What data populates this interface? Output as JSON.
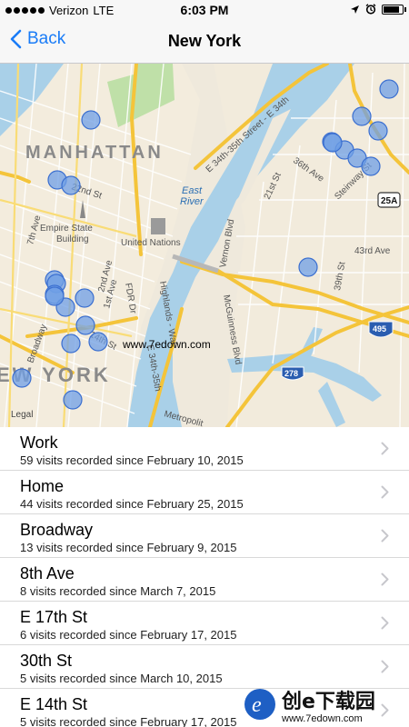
{
  "status_bar": {
    "carrier": "Verizon",
    "network": "LTE",
    "time": "6:03 PM",
    "battery_level": 0.92
  },
  "nav": {
    "back_label": "Back",
    "title": "New York"
  },
  "map": {
    "labels": {
      "manhattan": "MANHATTAN",
      "new_york": "EW YORK",
      "east_34th": "E 34th-35th Street - E 34th",
      "st_36": "36th Ave",
      "st_21": "21st St",
      "steinway": "Steinway St",
      "east_river_1": "East",
      "east_river_2": "River",
      "vernon": "Vernon Blvd",
      "ave_43": "43rd Ave",
      "st_39": "39th St",
      "mcguinness": "McGuinness Blvd",
      "empire_1": "Empire State",
      "empire_2": "Building",
      "un": "United Nations",
      "ave_7": "7th Ave",
      "ave_2": "2nd Ave",
      "ave_1": "1st Ave",
      "fdr": "FDR Dr",
      "highlands": "Highlands - Wal",
      "st_e34": "E 34th-35th",
      "broadway": "Broadway",
      "st_14": "14th St",
      "st_22": "22nd St",
      "metropolitan": "Metropolit",
      "legal": "Legal",
      "watermark": "www.7edown.com",
      "shield_25a": "25A",
      "shield_495": "495",
      "shield_278": "278"
    },
    "visit_markers_count": 26
  },
  "places": [
    {
      "name": "Work",
      "detail": "59 visits recorded since February 10, 2015"
    },
    {
      "name": "Home",
      "detail": "44 visits recorded since February 25, 2015"
    },
    {
      "name": "Broadway",
      "detail": "13 visits recorded since February 9, 2015"
    },
    {
      "name": "8th Ave",
      "detail": "8 visits recorded since March 7, 2015"
    },
    {
      "name": "E 17th St",
      "detail": "6 visits recorded since February 17, 2015"
    },
    {
      "name": "30th St",
      "detail": "5 visits recorded since March 10, 2015"
    },
    {
      "name": "E 14th St",
      "detail": "5 visits recorded since February 17, 2015"
    }
  ],
  "logo": {
    "text": "创e下载园",
    "url": "www.7edown.com"
  },
  "colors": {
    "ios_blue": "#1a7cf7",
    "marker_fill": "#6f9fe6",
    "marker_stroke": "#3b6fd0",
    "water": "#a9d0e8",
    "land": "#efe9dc",
    "park": "#bfe0a8",
    "highway": "#f4c43a"
  }
}
